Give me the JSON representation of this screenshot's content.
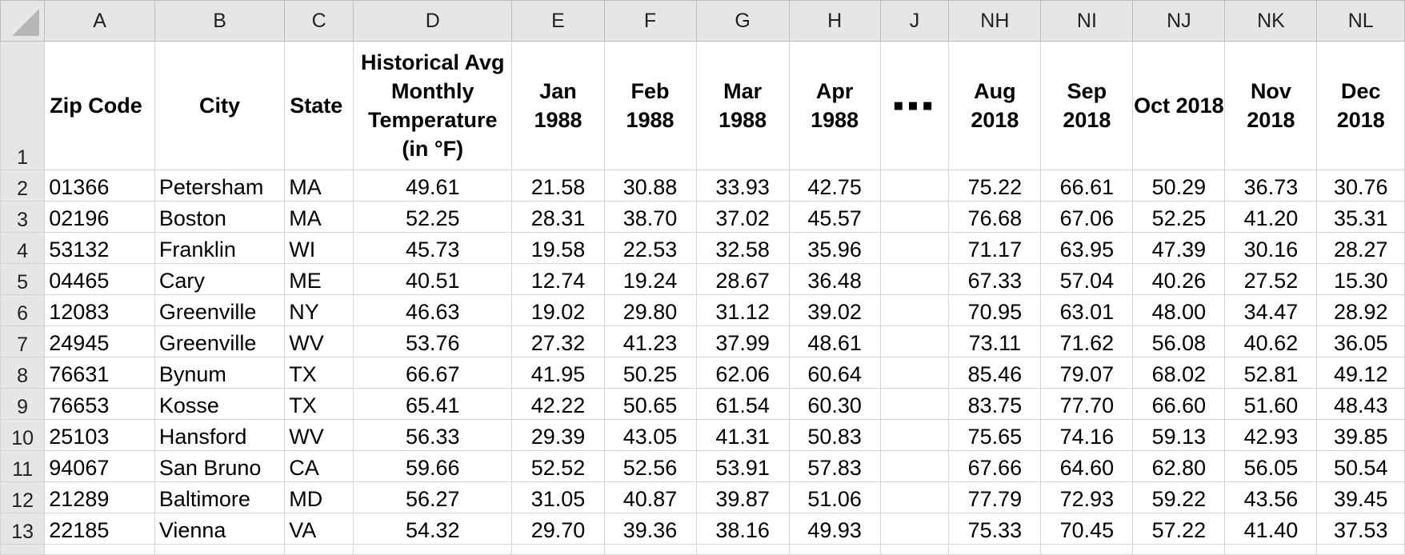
{
  "column_letters": [
    "A",
    "B",
    "C",
    "D",
    "E",
    "F",
    "G",
    "H",
    "J",
    "NH",
    "NI",
    "NJ",
    "NK",
    "NL"
  ],
  "header_row_number": "1",
  "headers": {
    "zip": "Zip Code",
    "city": "City",
    "state": "State",
    "hist": "Historical Avg Monthly Temperature (in °F)",
    "jan": "Jan 1988",
    "feb": "Feb 1988",
    "mar": "Mar 1988",
    "apr": "Apr 1988",
    "gap": "▪▪▪",
    "aug": "Aug 2018",
    "sep": "Sep 2018",
    "oct": "Oct 2018",
    "nov": "Nov 2018",
    "dec": "Dec 2018"
  },
  "rows": [
    {
      "n": "2",
      "zip": "01366",
      "city": "Petersham",
      "state": "MA",
      "hist": "49.61",
      "jan": "21.58",
      "feb": "30.88",
      "mar": "33.93",
      "apr": "42.75",
      "aug": "75.22",
      "sep": "66.61",
      "oct": "50.29",
      "nov": "36.73",
      "dec": "30.76"
    },
    {
      "n": "3",
      "zip": "02196",
      "city": "Boston",
      "state": "MA",
      "hist": "52.25",
      "jan": "28.31",
      "feb": "38.70",
      "mar": "37.02",
      "apr": "45.57",
      "aug": "76.68",
      "sep": "67.06",
      "oct": "52.25",
      "nov": "41.20",
      "dec": "35.31"
    },
    {
      "n": "4",
      "zip": "53132",
      "city": "Franklin",
      "state": "WI",
      "hist": "45.73",
      "jan": "19.58",
      "feb": "22.53",
      "mar": "32.58",
      "apr": "35.96",
      "aug": "71.17",
      "sep": "63.95",
      "oct": "47.39",
      "nov": "30.16",
      "dec": "28.27"
    },
    {
      "n": "5",
      "zip": "04465",
      "city": "Cary",
      "state": "ME",
      "hist": "40.51",
      "jan": "12.74",
      "feb": "19.24",
      "mar": "28.67",
      "apr": "36.48",
      "aug": "67.33",
      "sep": "57.04",
      "oct": "40.26",
      "nov": "27.52",
      "dec": "15.30"
    },
    {
      "n": "6",
      "zip": "12083",
      "city": "Greenville",
      "state": "NY",
      "hist": "46.63",
      "jan": "19.02",
      "feb": "29.80",
      "mar": "31.12",
      "apr": "39.02",
      "aug": "70.95",
      "sep": "63.01",
      "oct": "48.00",
      "nov": "34.47",
      "dec": "28.92"
    },
    {
      "n": "7",
      "zip": "24945",
      "city": "Greenville",
      "state": "WV",
      "hist": "53.76",
      "jan": "27.32",
      "feb": "41.23",
      "mar": "37.99",
      "apr": "48.61",
      "aug": "73.11",
      "sep": "71.62",
      "oct": "56.08",
      "nov": "40.62",
      "dec": "36.05"
    },
    {
      "n": "8",
      "zip": "76631",
      "city": "Bynum",
      "state": "TX",
      "hist": "66.67",
      "jan": "41.95",
      "feb": "50.25",
      "mar": "62.06",
      "apr": "60.64",
      "aug": "85.46",
      "sep": "79.07",
      "oct": "68.02",
      "nov": "52.81",
      "dec": "49.12"
    },
    {
      "n": "9",
      "zip": "76653",
      "city": "Kosse",
      "state": "TX",
      "hist": "65.41",
      "jan": "42.22",
      "feb": "50.65",
      "mar": "61.54",
      "apr": "60.30",
      "aug": "83.75",
      "sep": "77.70",
      "oct": "66.60",
      "nov": "51.60",
      "dec": "48.43"
    },
    {
      "n": "10",
      "zip": "25103",
      "city": "Hansford",
      "state": "WV",
      "hist": "56.33",
      "jan": "29.39",
      "feb": "43.05",
      "mar": "41.31",
      "apr": "50.83",
      "aug": "75.65",
      "sep": "74.16",
      "oct": "59.13",
      "nov": "42.93",
      "dec": "39.85"
    },
    {
      "n": "11",
      "zip": "94067",
      "city": "San Bruno",
      "state": "CA",
      "hist": "59.66",
      "jan": "52.52",
      "feb": "52.56",
      "mar": "53.91",
      "apr": "57.83",
      "aug": "67.66",
      "sep": "64.60",
      "oct": "62.80",
      "nov": "56.05",
      "dec": "50.54"
    },
    {
      "n": "12",
      "zip": "21289",
      "city": "Baltimore",
      "state": "MD",
      "hist": "56.27",
      "jan": "31.05",
      "feb": "40.87",
      "mar": "39.87",
      "apr": "51.06",
      "aug": "77.79",
      "sep": "72.93",
      "oct": "59.22",
      "nov": "43.56",
      "dec": "39.45"
    },
    {
      "n": "13",
      "zip": "22185",
      "city": "Vienna",
      "state": "VA",
      "hist": "54.32",
      "jan": "29.70",
      "feb": "39.36",
      "mar": "38.16",
      "apr": "49.93",
      "aug": "75.33",
      "sep": "70.45",
      "oct": "57.22",
      "nov": "41.40",
      "dec": "37.53"
    }
  ]
}
